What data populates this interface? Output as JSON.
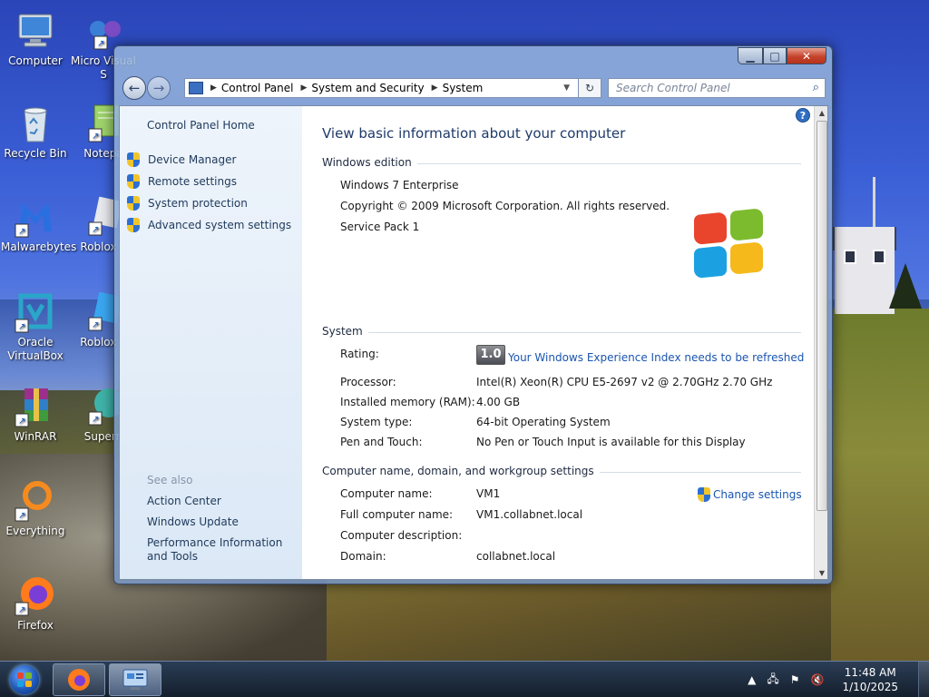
{
  "desktop": {
    "icons": [
      {
        "label": "Computer"
      },
      {
        "label": "Micro Visual S"
      },
      {
        "label": "Recycle Bin"
      },
      {
        "label": "Notepa"
      },
      {
        "label": "Malwarebytes"
      },
      {
        "label": "Roblox P"
      },
      {
        "label": "Oracle VirtualBox"
      },
      {
        "label": "Roblox S"
      },
      {
        "label": "WinRAR"
      },
      {
        "label": "Supern"
      },
      {
        "label": "Everything"
      },
      {
        "label": "Firefox"
      }
    ]
  },
  "window": {
    "breadcrumb": [
      "Control Panel",
      "System and Security",
      "System"
    ],
    "search_placeholder": "Search Control Panel",
    "left_pane": {
      "home": "Control Panel Home",
      "tasks": [
        "Device Manager",
        "Remote settings",
        "System protection",
        "Advanced system settings"
      ],
      "see_also_heading": "See also",
      "see_also": [
        "Action Center",
        "Windows Update",
        "Performance Information and Tools"
      ]
    },
    "main": {
      "heading": "View basic information about your computer",
      "edition_heading": "Windows edition",
      "edition_name": "Windows 7 Enterprise",
      "copyright": "Copyright © 2009 Microsoft Corporation.  All rights reserved.",
      "service_pack": "Service Pack 1",
      "system_heading": "System",
      "rating_label": "Rating:",
      "rating_score": "1.0",
      "rating_link": "Your Windows Experience Index needs to be refreshed",
      "processor_label": "Processor:",
      "processor_value": "Intel(R) Xeon(R) CPU E5-2697 v2 @ 2.70GHz   2.70 GHz",
      "memory_label": "Installed memory (RAM):",
      "memory_value": "4.00 GB",
      "systype_label": "System type:",
      "systype_value": "64-bit Operating System",
      "pen_label": "Pen and Touch:",
      "pen_value": "No Pen or Touch Input is available for this Display",
      "name_heading": "Computer name, domain, and workgroup settings",
      "change_settings": "Change settings",
      "cname_label": "Computer name:",
      "cname_value": "VM1",
      "fullname_label": "Full computer name:",
      "fullname_value": "VM1.collabnet.local",
      "desc_label": "Computer description:",
      "domain_label": "Domain:",
      "domain_value": "collabnet.local"
    }
  },
  "taskbar": {
    "time": "11:48 AM",
    "date": "1/10/2025"
  }
}
